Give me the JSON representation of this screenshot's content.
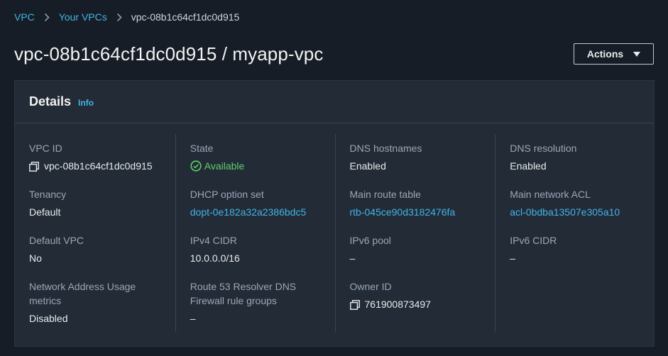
{
  "breadcrumb": {
    "items": [
      "VPC",
      "Your VPCs"
    ],
    "current": "vpc-08b1c64cf1dc0d915"
  },
  "page": {
    "title": "vpc-08b1c64cf1dc0d915 / myapp-vpc",
    "actions_label": "Actions"
  },
  "details": {
    "title": "Details",
    "info_label": "Info",
    "vpc_id": {
      "label": "VPC ID",
      "value": "vpc-08b1c64cf1dc0d915"
    },
    "tenancy": {
      "label": "Tenancy",
      "value": "Default"
    },
    "default_vpc": {
      "label": "Default VPC",
      "value": "No"
    },
    "nau_metrics": {
      "label_line1": "Network Address Usage",
      "label_line2": "metrics",
      "value": "Disabled"
    },
    "state": {
      "label": "State",
      "value": "Available"
    },
    "dhcp_option_set": {
      "label": "DHCP option set",
      "value": "dopt-0e182a32a2386bdc5"
    },
    "ipv4_cidr": {
      "label": "IPv4 CIDR",
      "value": "10.0.0.0/16"
    },
    "route53_dns_firewall": {
      "label_line1": "Route 53 Resolver DNS",
      "label_line2": "Firewall rule groups",
      "value": "–"
    },
    "dns_hostnames": {
      "label": "DNS hostnames",
      "value": "Enabled"
    },
    "main_route_table": {
      "label": "Main route table",
      "value": "rtb-045ce90d3182476fa"
    },
    "ipv6_pool": {
      "label": "IPv6 pool",
      "value": "–"
    },
    "owner_id": {
      "label": "Owner ID",
      "value": "761900873497"
    },
    "dns_resolution": {
      "label": "DNS resolution",
      "value": "Enabled"
    },
    "main_network_acl": {
      "label": "Main network ACL",
      "value": "acl-0bdba13507e305a10"
    },
    "ipv6_cidr": {
      "label": "IPv6 CIDR",
      "value": "–"
    }
  },
  "colors": {
    "background": "#161d26",
    "panel": "#232b37",
    "link": "#42b4e6",
    "success": "#5fd068",
    "label": "#9ba7b6",
    "text": "#e9ebed"
  },
  "icons": {
    "breadcrumb_separator": "chevron-right-icon",
    "copy": "copy-icon",
    "status": "check-circle-icon",
    "actions": "caret-down-icon"
  }
}
